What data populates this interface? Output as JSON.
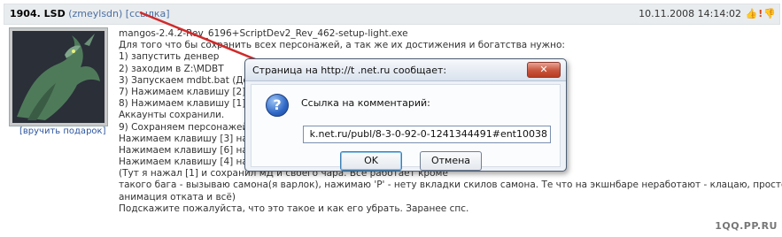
{
  "post": {
    "number": "1904",
    "author": "LSD",
    "username": "(zmeylsdn)",
    "link_label": "[ссылка]",
    "datetime": "10.11.2008 14:14:02",
    "gift_label": "[вручить подарок]",
    "lines": [
      "mangos-2.4.2-Rev_6196+ScriptDev2_Rev_462-setup-light.exe",
      "Для того что бы сохранить всех персонажей, а так же их достижения и богатства нужно:",
      "1) запустить денвер",
      "2) заходим в Z:\\MDBT",
      "3) Запускаем mdbt.bat (Дол",
      "7) Нажимаем клавишу [2] н",
      "8) Нажимаем клавишу [1] н                                                                                                   ы данных realmd\"",
      "Аккаунты сохранили.",
      "9) Сохраняем персонажей.",
      "Нажимаем клавишу [3] на к",
      "Нажимаем клавишу [6] на к",
      "Нажимаем клавишу [4] на к                                                                                                   ный файл",
      "(Тут я нажал [1] и сохранил                                                                                                  мД и своего чара. Всё работает кроме",
      "такого бага - вызываю самона(я варлок), нажимаю 'P' - нету вкладки скилов самона. Те что на экшнбаре неработают - клацаю, просто идёт",
      "анимация отката и всё)",
      "Подскажите пожалуйста, что это такое и как его убрать. Заранее спс."
    ]
  },
  "dialog": {
    "title": "Страница на http://t          .net.ru сообщает:",
    "close_label": "✕",
    "message": "Ссылка на комментарий:",
    "input_value": "k.net.ru/publ/8-3-0-92-0-1241344491#ent10038",
    "ok_label": "OK",
    "cancel_label": "Отмена",
    "icon": "question-icon"
  },
  "watermark": "1QQ.PP.RU",
  "icons": {
    "header": [
      "thumbs-up-icon",
      "exclamation-icon",
      "thumbs-down-icon"
    ]
  },
  "colors": {
    "header_bg": "#e9ecee",
    "link": "#4a6fa5",
    "arrow": "#d02a2a",
    "dialog_close": "#c8543c"
  }
}
